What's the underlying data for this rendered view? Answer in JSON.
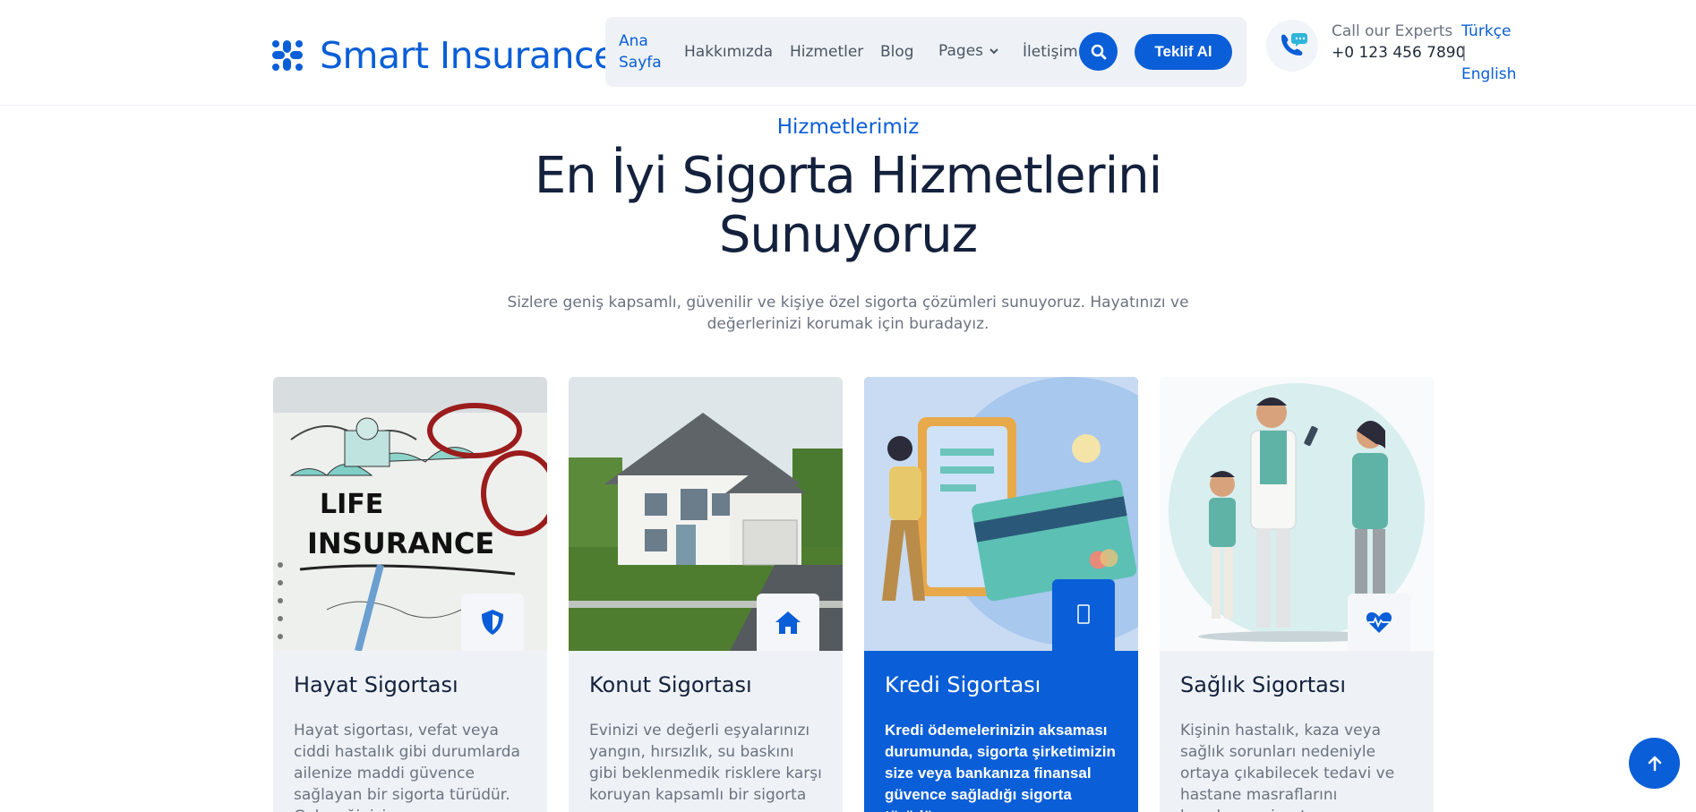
{
  "brand": {
    "name": "Smart Insurance",
    "icon": "slack-like-grid-icon"
  },
  "nav": {
    "home": "Ana Sayfa",
    "about": "Hakkımızda",
    "services": "Hizmetler",
    "blog": "Blog",
    "pages": "Pages",
    "contact": "İletişim",
    "quote_button": "Teklif Al"
  },
  "contact": {
    "label": "Call our Experts",
    "phone": "+0 123 456 7890"
  },
  "language": {
    "tr": "Türkçe",
    "separator": "|",
    "en": "English"
  },
  "section": {
    "eyebrow": "Hizmetlerimiz",
    "title": "En İyi Sigorta Hizmetlerini Sunuyoruz",
    "subtitle": "Sizlere geniş kapsamlı, güvenilir ve kişiye özel sigorta çözümleri sunuyoruz. Hayatınızı ve değerlerinizi korumak için buradayız."
  },
  "cards": [
    {
      "title": "Hayat Sigortası",
      "icon": "shield-icon",
      "description": "Hayat sigortası, vefat veya ciddi hastalık gibi durumlarda ailenize maddi güvence sağlayan bir sigorta türüdür. Geleceğinizi"
    },
    {
      "title": "Konut Sigortası",
      "icon": "home-icon",
      "description": "Evinizi ve değerli eşyalarınızı yangın, hırsızlık, su baskını gibi beklenmedik risklere karşı koruyan kapsamlı bir sigorta"
    },
    {
      "title": "Kredi Sigortası",
      "icon": "mobile-icon",
      "description": "Kredi ödemelerinizin aksaması durumunda, sigorta şirketimizin size veya bankanıza finansal güvence sağladığı sigorta türüdür."
    },
    {
      "title": "Sağlık Sigortası",
      "icon": "heartbeat-icon",
      "description": "Kişinin hastalık, kaza veya sağlık sorunları nedeniyle ortaya çıkabilecek tedavi ve hastane masraflarını karşılayan sigorta"
    }
  ],
  "colors": {
    "accent": "#0a5ed7",
    "heading": "#14213d",
    "muted": "#6b7280",
    "card_bg": "#eef2f6"
  }
}
